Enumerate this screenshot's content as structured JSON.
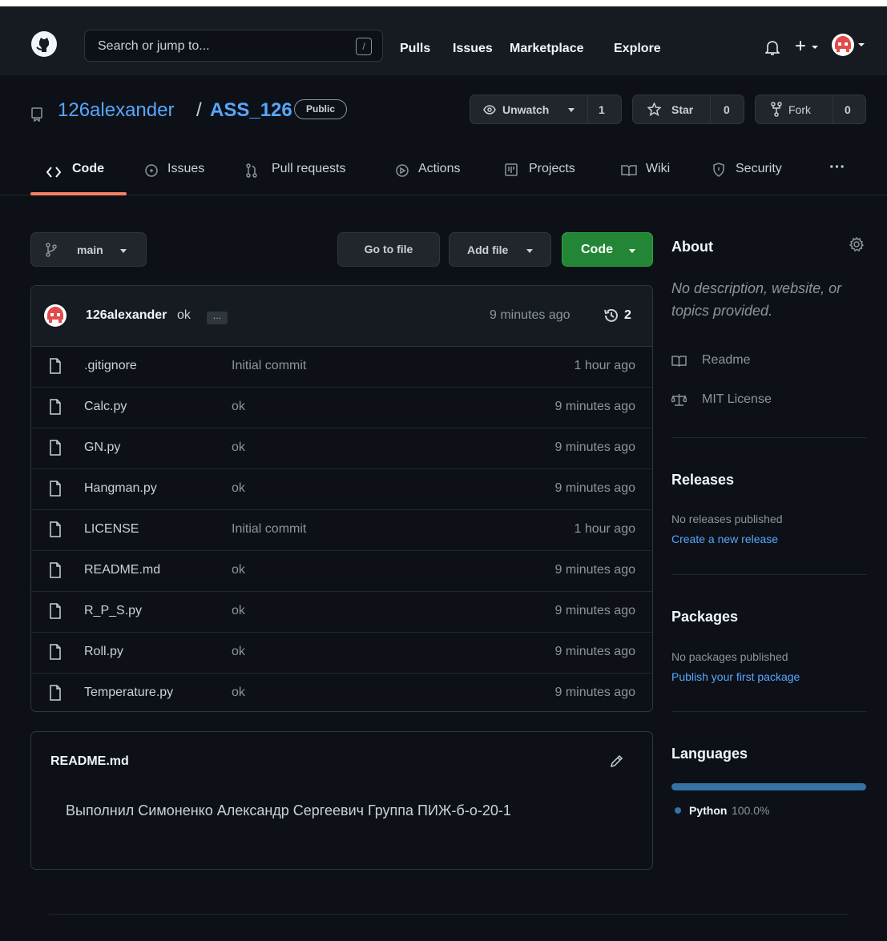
{
  "header": {
    "search_placeholder": "Search or jump to...",
    "slash_key": "/",
    "nav": [
      "Pulls",
      "Issues",
      "Marketplace",
      "Explore"
    ],
    "plus": "+"
  },
  "repo": {
    "owner": "126alexander",
    "separator": "/",
    "name": "ASS_126",
    "visibility": "Public",
    "unwatch_label": "Unwatch",
    "unwatch_count": "1",
    "star_label": "Star",
    "star_count": "0",
    "fork_label": "Fork",
    "fork_count": "0"
  },
  "tabs": [
    "Code",
    "Issues",
    "Pull requests",
    "Actions",
    "Projects",
    "Wiki",
    "Security"
  ],
  "more_tabs": "···",
  "toolbar": {
    "branch": "main",
    "go_to_file": "Go to file",
    "add_file": "Add file",
    "code": "Code"
  },
  "commit": {
    "author": "126alexander",
    "message": "ok",
    "ellipsis": "…",
    "time": "9 minutes ago",
    "count": "2"
  },
  "files": [
    {
      "name": ".gitignore",
      "message": "Initial commit",
      "time": "1 hour ago"
    },
    {
      "name": "Calc.py",
      "message": "ok",
      "time": "9 minutes ago"
    },
    {
      "name": "GN.py",
      "message": "ok",
      "time": "9 minutes ago"
    },
    {
      "name": "Hangman.py",
      "message": "ok",
      "time": "9 minutes ago"
    },
    {
      "name": "LICENSE",
      "message": "Initial commit",
      "time": "1 hour ago"
    },
    {
      "name": "README.md",
      "message": "ok",
      "time": "9 minutes ago"
    },
    {
      "name": "R_P_S.py",
      "message": "ok",
      "time": "9 minutes ago"
    },
    {
      "name": "Roll.py",
      "message": "ok",
      "time": "9 minutes ago"
    },
    {
      "name": "Temperature.py",
      "message": "ok",
      "time": "9 minutes ago"
    }
  ],
  "readme": {
    "title": "README.md",
    "content": "Выполнил Симоненко Александр Сергеевич Группа ПИЖ-б-о-20-1"
  },
  "about": {
    "title": "About",
    "description": "No description, website, or topics provided.",
    "readme_label": "Readme",
    "license_label": "MIT License"
  },
  "releases": {
    "title": "Releases",
    "empty": "No releases published",
    "link": "Create a new release"
  },
  "packages": {
    "title": "Packages",
    "empty": "No packages published",
    "link": "Publish your first package"
  },
  "languages": {
    "title": "Languages",
    "items": [
      {
        "name": "Python",
        "percent": "100.0%",
        "fraction": 1.0
      }
    ]
  },
  "colors": {
    "background": "#0d1117",
    "header": "#161b22",
    "link": "#58a6ff",
    "green_button": "#238636",
    "tab_underline": "#f78166",
    "python": "#3572a5"
  }
}
